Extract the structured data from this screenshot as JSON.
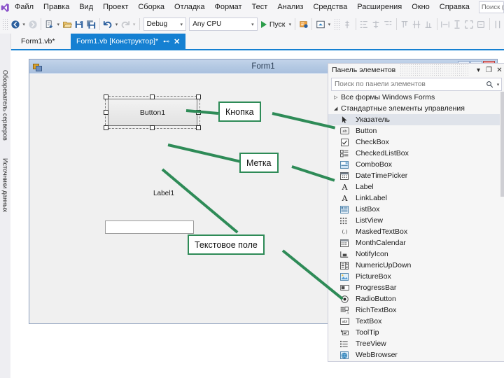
{
  "app": {
    "logo_icon": "visual-studio-logo"
  },
  "menubar": {
    "items": [
      {
        "label": "Файл"
      },
      {
        "label": "Правка"
      },
      {
        "label": "Вид"
      },
      {
        "label": "Проект"
      },
      {
        "label": "Сборка"
      },
      {
        "label": "Отладка"
      },
      {
        "label": "Формат"
      },
      {
        "label": "Тест"
      },
      {
        "label": "Анализ"
      },
      {
        "label": "Средства"
      },
      {
        "label": "Расширения"
      },
      {
        "label": "Окно"
      },
      {
        "label": "Справка"
      }
    ],
    "search_placeholder": "Поиск (Ctrl+"
  },
  "toolbar": {
    "config_value": "Debug",
    "platform_value": "Any CPU",
    "run_label": "Пуск",
    "back_icon": "navigate-back-icon",
    "forward_icon": "navigate-forward-icon",
    "new_project_icon": "new-project-icon",
    "open_icon": "open-file-icon",
    "save_icon": "save-icon",
    "save_all_icon": "save-all-icon",
    "undo_icon": "undo-icon",
    "redo_icon": "redo-icon",
    "run_icon": "start-debug-icon",
    "hot_reload_icon": "hot-reload-icon",
    "live_preview_icon": "live-preview-icon"
  },
  "tabs": [
    {
      "label": "Form1.vb*",
      "active": false
    },
    {
      "label": "Form1.vb [Конструктор]*",
      "active": true,
      "pin_icon": "pin-icon",
      "close_icon": "close-icon"
    }
  ],
  "left_dock": {
    "items": [
      {
        "label": "Обозреватель серверов"
      },
      {
        "label": "Источники данных"
      }
    ]
  },
  "designer": {
    "form_title": "Form1",
    "form_icon": "vb-form-icon",
    "minimize_icon": "minimize-icon",
    "maximize_icon": "maximize-icon",
    "close_icon": "close-icon",
    "controls": {
      "button_text": "Button1",
      "label_text": "Label1",
      "textbox_value": ""
    }
  },
  "toolbox": {
    "title": "Панель элементов",
    "search_placeholder": "Поиск по панели элементов",
    "search_icon": "magnifier-icon",
    "dropdown_icon": "chevron-down-icon",
    "pin_icon": "chevron-down-icon",
    "float_icon": "maximize-icon",
    "close_icon": "close-icon",
    "groups": [
      {
        "label": "Все формы Windows Forms",
        "expanded": false,
        "icon": "triangle-right-icon"
      },
      {
        "label": "Стандартные элементы управления",
        "expanded": true,
        "icon": "triangle-down-icon"
      }
    ],
    "items": [
      {
        "label": "Указатель",
        "icon": "pointer-icon",
        "selected": true
      },
      {
        "label": "Button",
        "icon": "button-icon",
        "selected": false
      },
      {
        "label": "CheckBox",
        "icon": "checkbox-icon",
        "selected": false
      },
      {
        "label": "CheckedListBox",
        "icon": "checkedlistbox-icon",
        "selected": false
      },
      {
        "label": "ComboBox",
        "icon": "combobox-icon",
        "selected": false
      },
      {
        "label": "DateTimePicker",
        "icon": "calendar-icon",
        "selected": false
      },
      {
        "label": "Label",
        "icon": "label-a-icon",
        "selected": false
      },
      {
        "label": "LinkLabel",
        "icon": "linklabel-a-icon",
        "selected": false
      },
      {
        "label": "ListBox",
        "icon": "listbox-icon",
        "selected": false
      },
      {
        "label": "ListView",
        "icon": "listview-icon",
        "selected": false
      },
      {
        "label": "MaskedTextBox",
        "icon": "maskedtextbox-icon",
        "selected": false
      },
      {
        "label": "MonthCalendar",
        "icon": "monthcalendar-icon",
        "selected": false
      },
      {
        "label": "NotifyIcon",
        "icon": "notifyicon-icon",
        "selected": false
      },
      {
        "label": "NumericUpDown",
        "icon": "numericupdown-icon",
        "selected": false
      },
      {
        "label": "PictureBox",
        "icon": "picturebox-icon",
        "selected": false
      },
      {
        "label": "ProgressBar",
        "icon": "progressbar-icon",
        "selected": false
      },
      {
        "label": "RadioButton",
        "icon": "radiobutton-icon",
        "selected": false
      },
      {
        "label": "RichTextBox",
        "icon": "richtextbox-icon",
        "selected": false
      },
      {
        "label": "TextBox",
        "icon": "textbox-icon",
        "selected": false
      },
      {
        "label": "ToolTip",
        "icon": "tooltip-icon",
        "selected": false
      },
      {
        "label": "TreeView",
        "icon": "treeview-icon",
        "selected": false
      },
      {
        "label": "WebBrowser",
        "icon": "webbrowser-icon",
        "selected": false
      }
    ]
  },
  "callouts": [
    {
      "label": "Кнопка",
      "target": "button-control"
    },
    {
      "label": "Метка",
      "target": "label-control"
    },
    {
      "label": "Текстовое поле",
      "target": "textbox-control"
    }
  ],
  "colors": {
    "accent_blue": "#1580d2",
    "callout_green": "#2e8b57",
    "run_green": "#2e9e4c",
    "form_caption": "#b4c9e3"
  }
}
